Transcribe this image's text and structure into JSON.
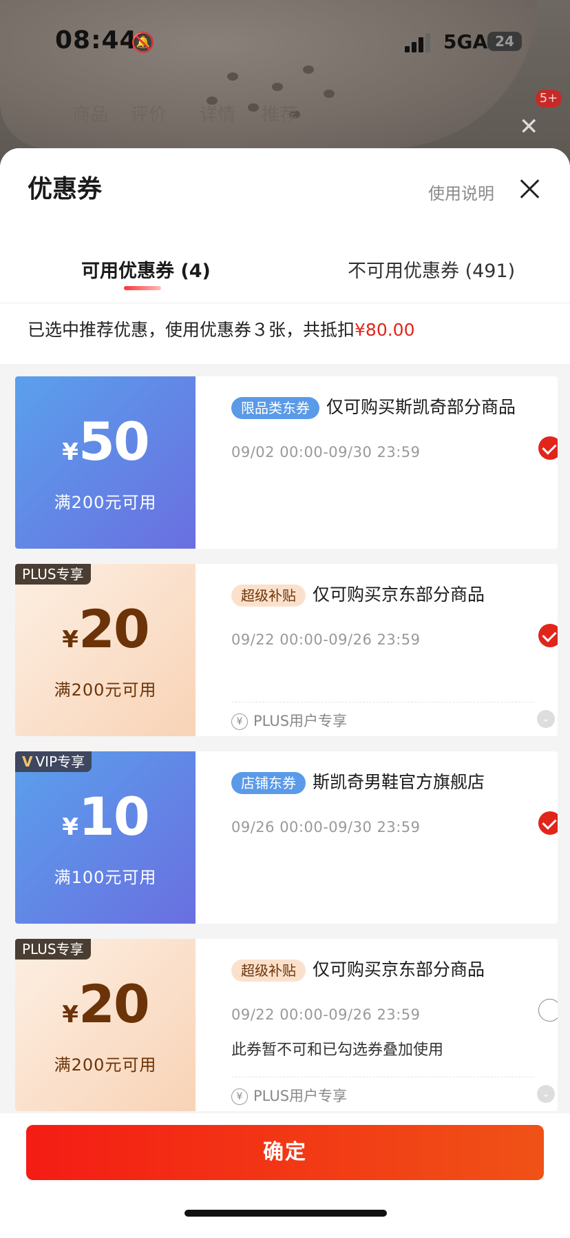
{
  "status_bar": {
    "time": "08:44",
    "network": "5GA",
    "battery": "24"
  },
  "background_page": {
    "cart_badge": "5+",
    "nav_items": [
      "商品",
      "评价",
      "详情",
      "推荐"
    ]
  },
  "sheet": {
    "title": "优惠券",
    "help_link": "使用说明",
    "tabs": [
      {
        "label": "可用优惠券 (4)",
        "active": true
      },
      {
        "label": "不可用优惠券 (491)",
        "active": false
      }
    ],
    "summary_text": "已选中推荐优惠，使用优惠券３张，共抵扣",
    "summary_amount": "¥80.00"
  },
  "coupons": [
    {
      "currency": "¥",
      "amount": "50",
      "condition": "满200元可用",
      "badge": "限品类东券",
      "description": "仅可购买斯凯奇部分商品",
      "validity": "09/02 00:00-09/30 23:59",
      "selected": true
    },
    {
      "corner_tag": "PLUS专享",
      "currency": "¥",
      "amount": "20",
      "condition": "满200元可用",
      "badge": "超级补贴",
      "description": "仅可购买京东部分商品",
      "validity": "09/22 00:00-09/26 23:59",
      "footer": "PLUS用户专享",
      "selected": true
    },
    {
      "corner_tag": "VIP专享",
      "currency": "¥",
      "amount": "10",
      "condition": "满100元可用",
      "badge": "店铺东券",
      "description": "斯凯奇男鞋官方旗舰店",
      "validity": "09/26 00:00-09/30 23:59",
      "selected": true
    },
    {
      "corner_tag": "PLUS专享",
      "currency": "¥",
      "amount": "20",
      "condition": "满200元可用",
      "badge": "超级补贴",
      "description": "仅可购买京东部分商品",
      "validity": "09/22 00:00-09/26 23:59",
      "note": "此券暂不可和已勾选券叠加使用",
      "footer": "PLUS用户专享",
      "selected": false
    }
  ],
  "confirm_button": "确定",
  "colors": {
    "accent_red": "#e1251b",
    "blue_coupon": "#5a9ae8",
    "peach_coupon": "#f8d3b6"
  }
}
